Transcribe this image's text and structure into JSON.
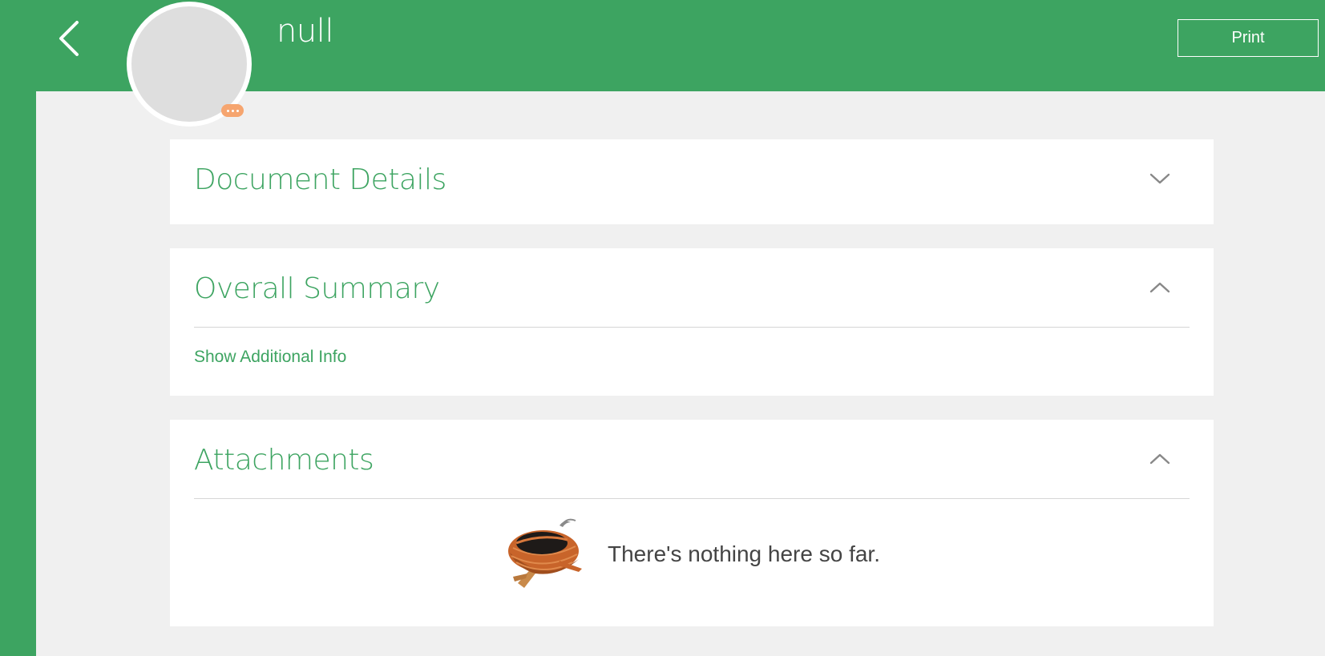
{
  "header": {
    "back_icon": "chevron-left-icon",
    "record_title": "null",
    "print_label": "Print",
    "avatar_badge_icon": "more-dots-icon",
    "accent_color": "#3da461",
    "badge_color": "#f6a56f"
  },
  "sections": {
    "document_details": {
      "title": "Document Details",
      "expanded": false,
      "toggle_icon": "chevron-down-icon"
    },
    "overall_summary": {
      "title": "Overall Summary",
      "expanded": true,
      "toggle_icon": "chevron-up-icon",
      "link_label": "Show Additional Info"
    },
    "attachments": {
      "title": "Attachments",
      "expanded": true,
      "toggle_icon": "chevron-up-icon",
      "empty_icon": "empty-nest-icon",
      "empty_message": "There's nothing here so far."
    }
  }
}
